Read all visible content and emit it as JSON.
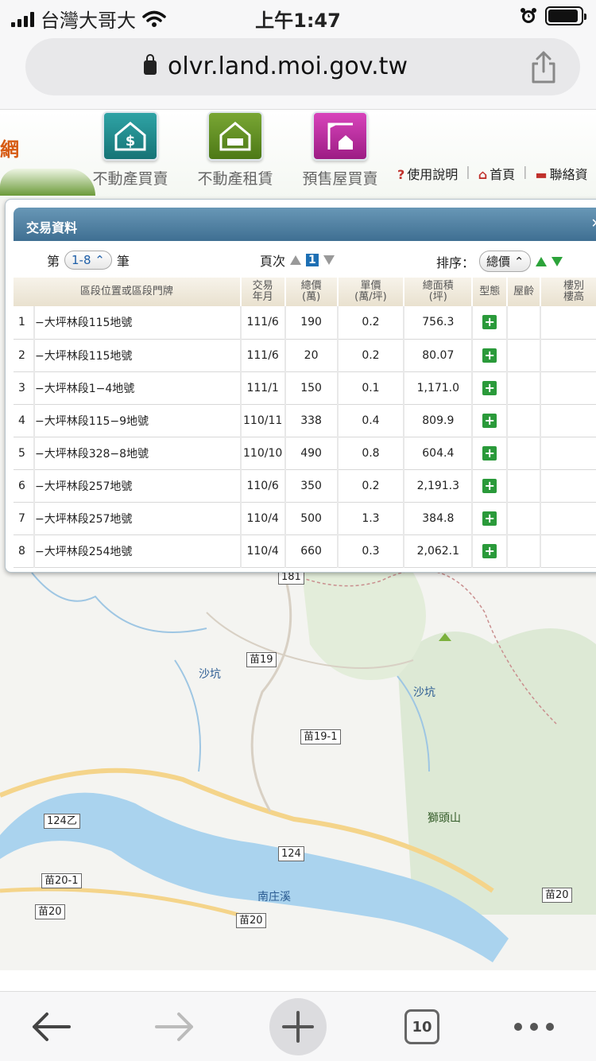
{
  "status_bar": {
    "carrier": "台灣大哥大",
    "time": "上午1:47"
  },
  "browser": {
    "url": "olvr.land.moi.gov.tw",
    "tab_count": "10"
  },
  "header": {
    "logo_fragment": "網",
    "nav": [
      {
        "label": "不動產買賣",
        "color": "#1f8a8c"
      },
      {
        "label": "不動產租賃",
        "color": "#5e8a22"
      },
      {
        "label": "預售屋買賣",
        "color": "#b4279b"
      }
    ],
    "links": {
      "help": "使用說明",
      "home": "首頁",
      "contact": "聯絡資"
    }
  },
  "panel": {
    "title": "交易資料",
    "range_prefix": "第",
    "range_value": "1-8",
    "range_suffix": "筆",
    "page_label": "頁次",
    "page_value": "1",
    "sort_label": "排序：",
    "sort_value": "總價"
  },
  "table": {
    "headers": [
      "區段位置或區段門牌",
      "交易\n年月",
      "總價\n(萬)",
      "單價\n(萬/坪)",
      "總面積\n(坪)",
      "型態",
      "屋齡",
      "樓別\n樓高"
    ],
    "rows": [
      {
        "no": "1",
        "address": "−大坪林段115地號",
        "date": "111/6",
        "total": "190",
        "unit": "0.2",
        "area": "756.3"
      },
      {
        "no": "2",
        "address": "−大坪林段115地號",
        "date": "111/6",
        "total": "20",
        "unit": "0.2",
        "area": "80.07"
      },
      {
        "no": "3",
        "address": "−大坪林段1−4地號",
        "date": "111/1",
        "total": "150",
        "unit": "0.1",
        "area": "1,171.0"
      },
      {
        "no": "4",
        "address": "−大坪林段115−9地號",
        "date": "110/11",
        "total": "338",
        "unit": "0.4",
        "area": "809.9"
      },
      {
        "no": "5",
        "address": "−大坪林段328−8地號",
        "date": "110/10",
        "total": "490",
        "unit": "0.8",
        "area": "604.4"
      },
      {
        "no": "6",
        "address": "−大坪林段257地號",
        "date": "110/6",
        "total": "350",
        "unit": "0.2",
        "area": "2,191.3"
      },
      {
        "no": "7",
        "address": "−大坪林段257地號",
        "date": "110/4",
        "total": "500",
        "unit": "1.3",
        "area": "384.8"
      },
      {
        "no": "8",
        "address": "−大坪林段254地號",
        "date": "110/4",
        "total": "660",
        "unit": "0.3",
        "area": "2,062.1"
      }
    ]
  },
  "map": {
    "roads": [
      "181",
      "苗19",
      "苗19-1",
      "124乙",
      "124",
      "苗20-1",
      "苗20",
      "苗20",
      "苗20"
    ],
    "places": [
      "沙坑",
      "沙坑",
      "南庄溪",
      "獅頭山"
    ]
  }
}
